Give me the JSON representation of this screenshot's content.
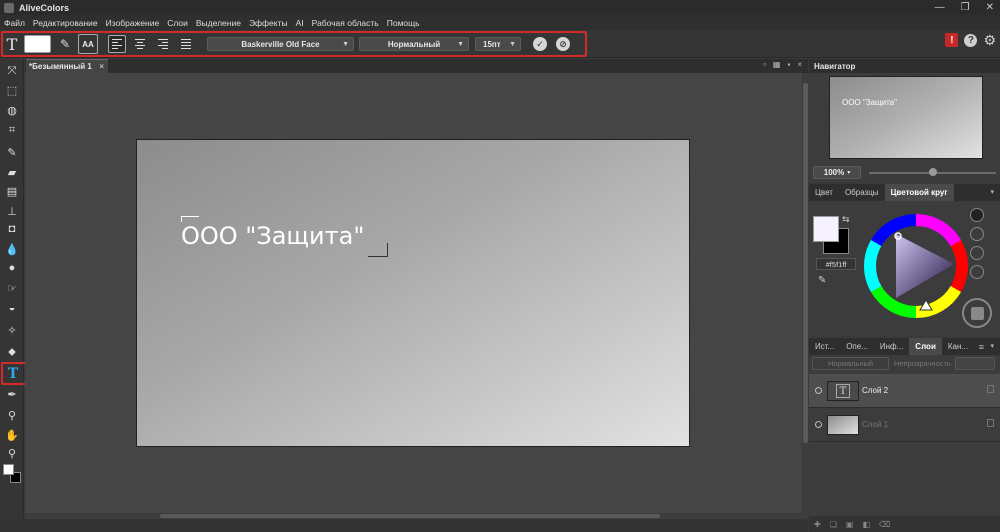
{
  "app": {
    "title": "AliveColors"
  },
  "window_controls": [
    "—",
    "❐",
    "✕"
  ],
  "menu": [
    "Файл",
    "Редактирование",
    "Изображение",
    "Слои",
    "Выделение",
    "Эффекты",
    "AI",
    "Рабочая область",
    "Помощь"
  ],
  "options": {
    "text_glyph": "T",
    "text_color": "#ffffff",
    "aa_label": "AA",
    "font_family": "Baskerville Old Face",
    "font_style": "Нормальный",
    "font_size": "15пт",
    "apply_glyph": "✓",
    "cancel_glyph": "⊘"
  },
  "top_right": {
    "alert": "!",
    "help": "?",
    "settings": "⚙"
  },
  "document": {
    "tab_label": "*Безымянный 1",
    "tab_close": "×",
    "tab_icons": [
      "▫",
      "▦",
      "▪",
      "×"
    ],
    "canvas_text": "ООО \"Защита\"",
    "canvas_gradient": [
      "#8c8c8c",
      "#e2e2e2"
    ]
  },
  "navigator": {
    "title": "Навигатор",
    "thumb_text": "ООО \"Защита\"",
    "zoom": "100%",
    "zoom_caret": "▾",
    "zoom_level": 0.5
  },
  "color_panel": {
    "tabs": [
      "Цвет",
      "Образцы",
      "Цветовой круг"
    ],
    "active_tab": "Цветовой круг",
    "menu_caret": "▾",
    "swap_glyph": "⇆",
    "hex_value": "#f5f1ff",
    "primary_color": "#f5f1ff",
    "secondary_color": "#000000",
    "picker_glyph": "✎"
  },
  "layers_panel": {
    "tabs": [
      "Ист...",
      "Опе...",
      "Инф...",
      "Слои",
      "Кан..."
    ],
    "active_tab": "Слои",
    "menu_glyph": "≡",
    "menu_caret": "▾",
    "blend_mode": "Нормальный",
    "opacity_label": "Непрозрачность",
    "text_thumb_glyph": "T",
    "layers": [
      {
        "name": "Слой 2",
        "type": "text",
        "active": true
      },
      {
        "name": "Слой 1",
        "type": "image",
        "active": false
      }
    ],
    "footer_icons": [
      "✚",
      "❏",
      "▣",
      "◧",
      "⌫"
    ]
  },
  "tools": [
    {
      "name": "move-tool-icon",
      "glyph": "⤧"
    },
    {
      "name": "marquee-tool-icon",
      "glyph": "⬚"
    },
    {
      "name": "lasso-tool-icon",
      "glyph": "◍"
    },
    {
      "name": "crop-tool-icon",
      "glyph": "⌗"
    },
    {
      "name": "brush-tool-icon",
      "glyph": "✎"
    },
    {
      "name": "eraser-tool-icon",
      "glyph": "▰"
    },
    {
      "name": "gradient-tool-icon",
      "glyph": "▤"
    },
    {
      "name": "stamp-tool-icon",
      "glyph": "⊥"
    },
    {
      "name": "fill-tool-icon",
      "glyph": "◘"
    },
    {
      "name": "drop-tool-icon",
      "glyph": "💧"
    },
    {
      "name": "dodge-tool-icon",
      "glyph": "●"
    },
    {
      "name": "smudge-tool-icon",
      "glyph": "☞"
    },
    {
      "name": "sponge-tool-icon",
      "glyph": "◒"
    },
    {
      "name": "magic-tool-icon",
      "glyph": "✧"
    },
    {
      "name": "shape-tool-icon",
      "glyph": "⬥"
    },
    {
      "name": "pen-tool-icon",
      "glyph": "✒"
    },
    {
      "name": "eyedropper-tool-icon",
      "glyph": "⚲"
    },
    {
      "name": "hand-tool-icon",
      "glyph": "✋"
    },
    {
      "name": "zoom-tool-icon",
      "glyph": "⚲"
    }
  ],
  "text_tool": {
    "glyph": "T",
    "accent": "#2ea8e8"
  },
  "highlight_color": "#d42a2a"
}
